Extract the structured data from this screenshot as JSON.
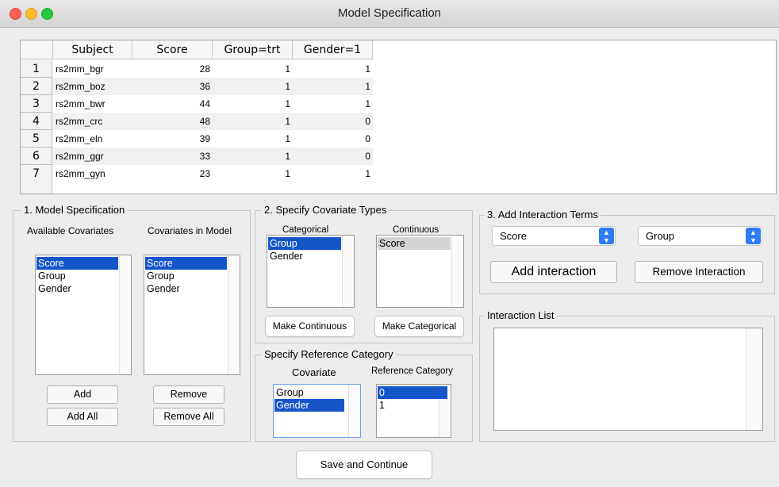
{
  "window": {
    "title": "Model Specification",
    "colors": {
      "close": "#fe5f57",
      "minimize": "#febc2e",
      "zoom": "#28c840",
      "selection": "#1456c9",
      "accent": "#2e7cf6"
    }
  },
  "table": {
    "columns": [
      "Subject",
      "Score",
      "Group=trt",
      "Gender=1"
    ],
    "rows": [
      {
        "n": "1",
        "subject": "rs2mm_bgr",
        "score": "28",
        "group": "1",
        "gender": "1"
      },
      {
        "n": "2",
        "subject": "rs2mm_boz",
        "score": "36",
        "group": "1",
        "gender": "1"
      },
      {
        "n": "3",
        "subject": "rs2mm_bwr",
        "score": "44",
        "group": "1",
        "gender": "1"
      },
      {
        "n": "4",
        "subject": "rs2mm_crc",
        "score": "48",
        "group": "1",
        "gender": "0"
      },
      {
        "n": "5",
        "subject": "rs2mm_eln",
        "score": "39",
        "group": "1",
        "gender": "0"
      },
      {
        "n": "6",
        "subject": "rs2mm_ggr",
        "score": "33",
        "group": "1",
        "gender": "0"
      },
      {
        "n": "7",
        "subject": "rs2mm_gyn",
        "score": "23",
        "group": "1",
        "gender": "1"
      }
    ]
  },
  "model_spec": {
    "title": "1. Model Specification",
    "available_label": "Available Covariates",
    "in_model_label": "Covariates in Model",
    "available": [
      "Score",
      "Group",
      "Gender"
    ],
    "available_selected": "Score",
    "in_model": [
      "Score",
      "Group",
      "Gender"
    ],
    "in_model_selected": "Score",
    "add": "Add",
    "add_all": "Add All",
    "remove": "Remove",
    "remove_all": "Remove All"
  },
  "covariate_types": {
    "title": "2. Specify Covariate Types",
    "categorical_label": "Categorical",
    "continuous_label": "Continuous",
    "categorical": [
      "Group",
      "Gender"
    ],
    "categorical_selected": "Group",
    "continuous": [
      "Score"
    ],
    "make_continuous": "Make Continuous",
    "make_categorical": "Make Categorical"
  },
  "reference": {
    "title": "Specify Reference Category",
    "covariate_label": "Covariate",
    "reference_label": "Reference Category",
    "covariates": [
      "Group",
      "Gender"
    ],
    "covariate_selected": "Gender",
    "categories": [
      "0",
      "1"
    ],
    "category_selected": "0"
  },
  "interaction": {
    "title": "3. Add Interaction Terms",
    "select1": "Score",
    "select2": "Group",
    "add": "Add interaction",
    "remove": "Remove Interaction",
    "list_title": "Interaction List"
  },
  "footer": {
    "save": "Save and Continue"
  }
}
